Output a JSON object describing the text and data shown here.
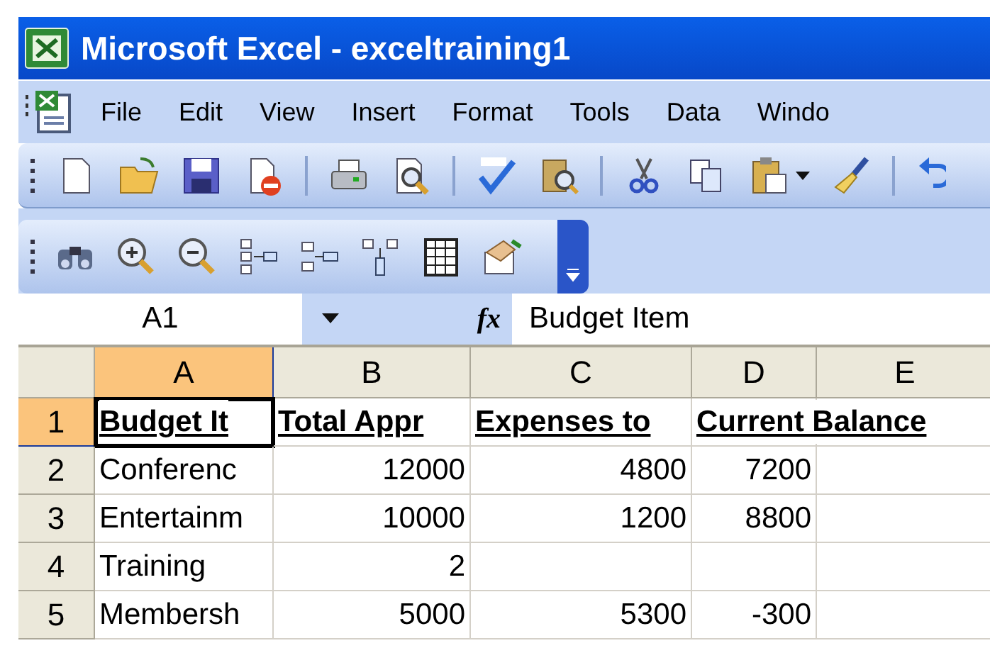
{
  "window": {
    "title": "Microsoft Excel - exceltraining1"
  },
  "menu": [
    "File",
    "Edit",
    "View",
    "Insert",
    "Format",
    "Tools",
    "Data",
    "Windo"
  ],
  "formula_bar": {
    "name_box": "A1",
    "function_label": "fx",
    "value": "Budget Item"
  },
  "columns": [
    {
      "label": "A",
      "selected": true
    },
    {
      "label": "B",
      "selected": false
    },
    {
      "label": "C",
      "selected": false
    },
    {
      "label": "D",
      "selected": false
    },
    {
      "label": "E",
      "selected": false
    }
  ],
  "rows": [
    {
      "number": "1",
      "selected": true,
      "kind": "heading",
      "cells": [
        "Budget It",
        "Total Appr",
        "Expenses to",
        "Current Balance",
        ""
      ]
    },
    {
      "number": "2",
      "selected": false,
      "kind": "data",
      "cells": [
        "Conferenc",
        "12000",
        "4800",
        "7200",
        ""
      ]
    },
    {
      "number": "3",
      "selected": false,
      "kind": "data",
      "cells": [
        "Entertainm",
        "10000",
        "1200",
        "8800",
        ""
      ]
    },
    {
      "number": "4",
      "selected": false,
      "kind": "data",
      "cells": [
        "Training",
        "2",
        "",
        "",
        ""
      ]
    },
    {
      "number": "5",
      "selected": false,
      "kind": "data",
      "cells": [
        "Membersh",
        "5000",
        "5300",
        "-300",
        ""
      ]
    }
  ]
}
